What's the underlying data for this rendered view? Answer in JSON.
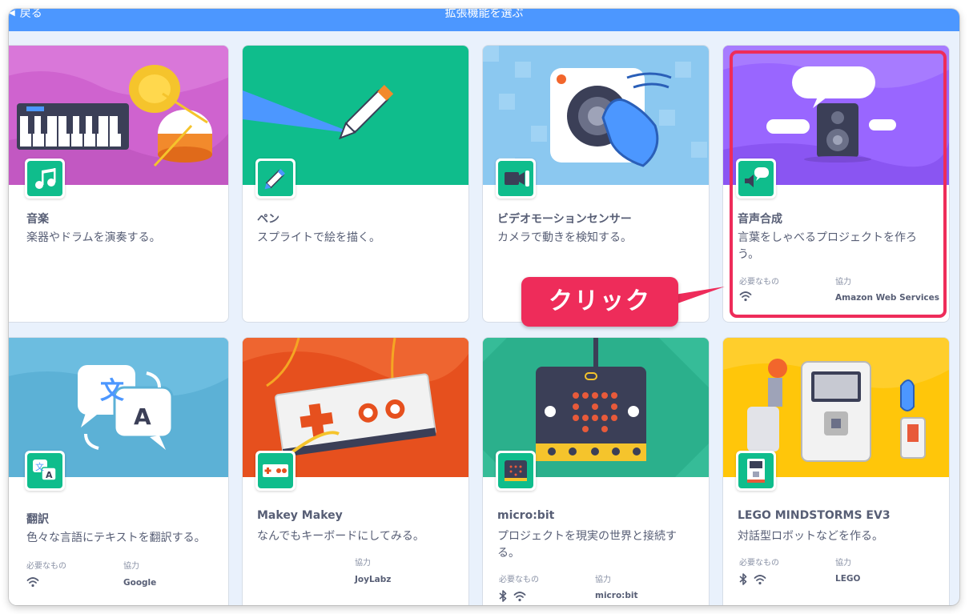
{
  "header": {
    "back_label": "戻る",
    "title": "拡張機能を選ぶ",
    "color": "#4c97ff"
  },
  "meta_labels": {
    "required": "必要なもの",
    "collaboration": "協力"
  },
  "extensions": [
    {
      "title": "音楽",
      "description": "楽器やドラムを演奏する。",
      "bg": "#cf63cf"
    },
    {
      "title": "ペン",
      "description": "スプライトで絵を描く。",
      "bg": "#0fbd8c"
    },
    {
      "title": "ビデオモーションセンサー",
      "description": "カメラで動きを検知する。",
      "bg": "#8bc8f0"
    },
    {
      "title": "音声合成",
      "description": "言葉をしゃべるプロジェクトを作ろう。",
      "requires": [
        "wifi-icon"
      ],
      "collaborator": "Amazon Web Services",
      "bg": "#9966ff"
    },
    {
      "title": "翻訳",
      "description": "色々な言語にテキストを翻訳する。",
      "requires": [
        "wifi-icon"
      ],
      "collaborator": "Google",
      "bg": "#5cb1d6"
    },
    {
      "title": "Makey Makey",
      "description": "なんでもキーボードにしてみる。",
      "collaborator": "JoyLabz",
      "bg": "#e6501e"
    },
    {
      "title": "micro:bit",
      "description": "プロジェクトを現実の世界と接続する。",
      "requires": [
        "bluetooth-icon",
        "wifi-icon"
      ],
      "collaborator": "micro:bit",
      "bg": "#2bb08c"
    },
    {
      "title": "LEGO MINDSTORMS EV3",
      "description": "対話型ロボットなどを作る。",
      "requires": [
        "bluetooth-icon",
        "wifi-icon"
      ],
      "collaborator": "LEGO",
      "bg": "#ffc60a"
    }
  ],
  "callout": {
    "label": "クリック",
    "color": "#ee2c5a"
  }
}
